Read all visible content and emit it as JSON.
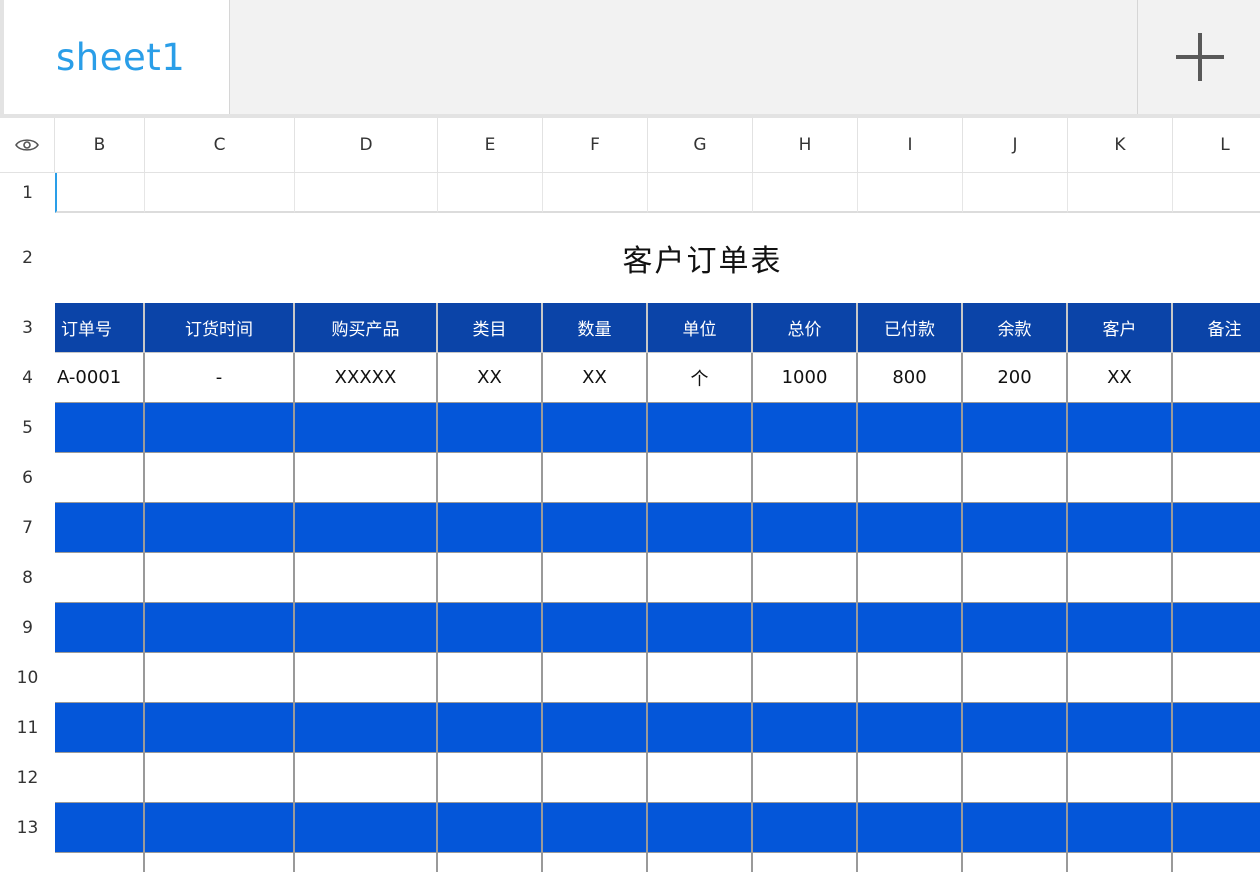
{
  "sheet_tabs": [
    {
      "label": "sheet1",
      "active": true
    }
  ],
  "add_sheet_icon": "plus-icon",
  "visibility_icon": "eye-icon",
  "columns": [
    "B",
    "C",
    "D",
    "E",
    "F",
    "G",
    "H",
    "I",
    "J",
    "K",
    "L"
  ],
  "rows": [
    "1",
    "2",
    "3",
    "4",
    "5",
    "6",
    "7",
    "8",
    "9",
    "10",
    "11",
    "12",
    "13"
  ],
  "title": "客户订单表",
  "table_headers": [
    "订单号",
    "订货时间",
    "购买产品",
    "类目",
    "数量",
    "单位",
    "总价",
    "已付款",
    "余款",
    "客户",
    "备注"
  ],
  "first_record": [
    "A-0001",
    "-",
    "XXXXX",
    "XX",
    "XX",
    "个",
    "1000",
    "800",
    "200",
    "XX",
    ""
  ],
  "colors": {
    "header_bg": "#0b44a8",
    "stripe_bg": "#0456d9",
    "tab_text": "#2a9ee8",
    "selection": "#2a9ee8"
  }
}
